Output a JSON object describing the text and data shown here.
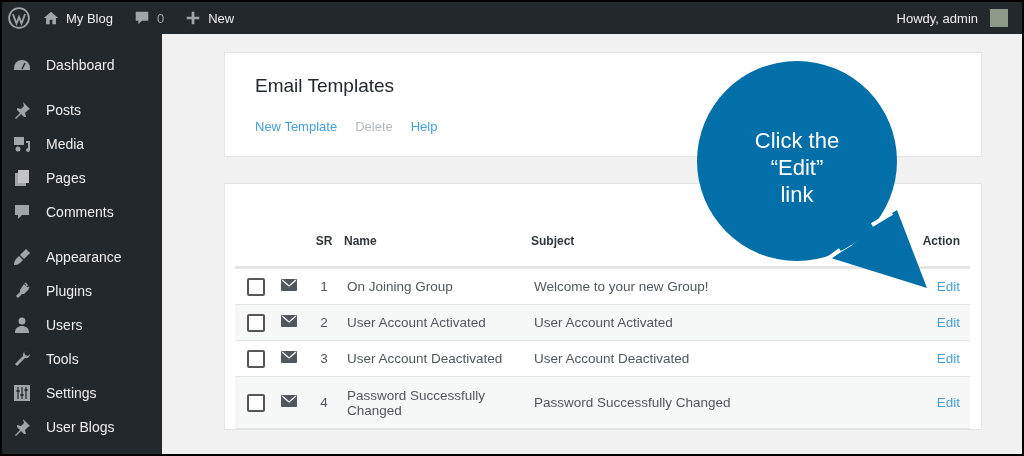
{
  "admin_bar": {
    "site_name": "My Blog",
    "comments_count": "0",
    "new_label": "New",
    "greeting": "Howdy, admin"
  },
  "sidebar": {
    "items": [
      {
        "label": "Dashboard"
      },
      {
        "label": "Posts"
      },
      {
        "label": "Media"
      },
      {
        "label": "Pages"
      },
      {
        "label": "Comments"
      },
      {
        "label": "Appearance"
      },
      {
        "label": "Plugins"
      },
      {
        "label": "Users"
      },
      {
        "label": "Tools"
      },
      {
        "label": "Settings"
      },
      {
        "label": "User Blogs"
      }
    ]
  },
  "header_card": {
    "title": "Email Templates",
    "actions": [
      {
        "label": "New Template",
        "disabled": false
      },
      {
        "label": "Delete",
        "disabled": true
      },
      {
        "label": "Help",
        "disabled": false
      }
    ]
  },
  "table": {
    "columns": [
      "SR",
      "Name",
      "Subject",
      "Action"
    ],
    "rows": [
      {
        "checked": false,
        "sr": "1",
        "name": "On Joining Group",
        "subject": "Welcome to your new Group!",
        "action": "Edit"
      },
      {
        "checked": false,
        "sr": "2",
        "name": "User Account Activated",
        "subject": "User Account Activated",
        "action": "Edit"
      },
      {
        "checked": false,
        "sr": "3",
        "name": "User Account Deactivated",
        "subject": "User Account Deactivated",
        "action": "Edit"
      },
      {
        "checked": false,
        "sr": "4",
        "name": "Password Successfully Changed",
        "subject": "Password Successfully Changed",
        "action": "Edit"
      }
    ]
  },
  "callout": {
    "lines": [
      "Click the",
      "“Edit”",
      "link"
    ]
  }
}
